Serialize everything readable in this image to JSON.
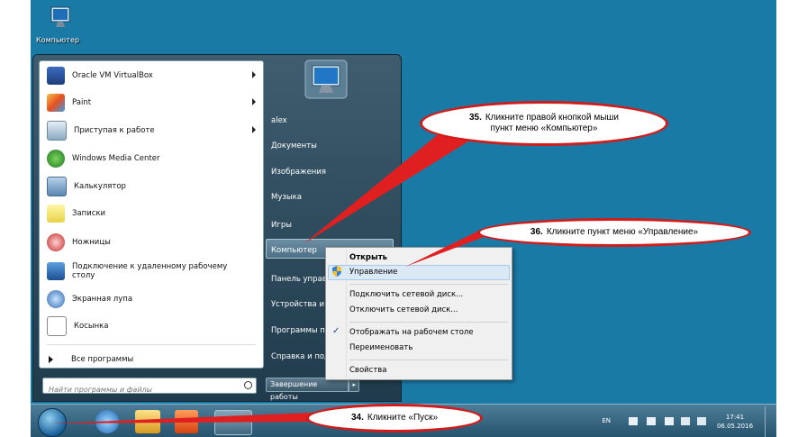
{
  "desktop": {
    "icon_label": "Компьютер"
  },
  "start_menu": {
    "programs": [
      {
        "label": "Oracle VM VirtualBox",
        "has_submenu": true,
        "icon": "virtualbox-icon"
      },
      {
        "label": "Paint",
        "has_submenu": true,
        "icon": "paint-icon"
      },
      {
        "label": "Приступая к работе",
        "has_submenu": true,
        "icon": "getting-started-icon"
      },
      {
        "label": "Windows Media Center",
        "has_submenu": false,
        "icon": "media-center-icon"
      },
      {
        "label": "Калькулятор",
        "has_submenu": false,
        "icon": "calculator-icon"
      },
      {
        "label": "Записки",
        "has_submenu": false,
        "icon": "sticky-notes-icon"
      },
      {
        "label": "Ножницы",
        "has_submenu": false,
        "icon": "scissors-icon"
      },
      {
        "label": "Подключение к удаленному рабочему",
        "label2": "столу",
        "has_submenu": false,
        "icon": "remote-desktop-icon"
      },
      {
        "label": "Экранная лупа",
        "has_submenu": false,
        "icon": "magnifier-icon"
      },
      {
        "label": "Косынка",
        "has_submenu": false,
        "icon": "solitaire-icon"
      }
    ],
    "all_programs": "Все программы",
    "search_placeholder": "Найти программы и файлы",
    "right_items": [
      "alex",
      "Документы",
      "Изображения",
      "Музыка",
      "Игры",
      "Компьютер",
      "Панель управ",
      "Устройства и",
      "Программы п",
      "Справка и под"
    ],
    "shutdown_label": "Завершение работы"
  },
  "context_menu": {
    "items": [
      {
        "label": "Открыть",
        "bold": true
      },
      {
        "label": "Управление",
        "highlighted": true,
        "icon": "shield-icon"
      },
      {
        "label": "Подключить сетевой диск..."
      },
      {
        "label": "Отключить сетевой диск..."
      },
      {
        "label": "Отображать на рабочем столе",
        "checked": true
      },
      {
        "label": "Переименовать"
      },
      {
        "label": "Свойства"
      }
    ]
  },
  "taskbar": {
    "lang": "EN",
    "time": "17:41",
    "date": "06.05.2016"
  },
  "callouts": [
    {
      "num": "35.",
      "text": "Кликните правой кнопкой мыши",
      "text2": "пункт меню «Компьютер»"
    },
    {
      "num": "36.",
      "text": "Кликните пункт меню «Управление»"
    },
    {
      "num": "34.",
      "text": "Кликните «Пуск»"
    }
  ],
  "colors": {
    "desktop": "#1a7aa6",
    "callout_border": "#d21b1b",
    "highlight": "#dbe8f6"
  }
}
